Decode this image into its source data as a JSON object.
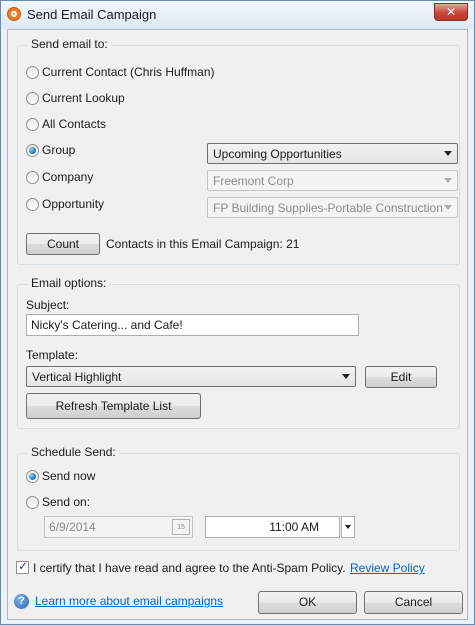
{
  "window": {
    "title": "Send Email Campaign",
    "close_glyph": "✕"
  },
  "send_to": {
    "legend": "Send email to:",
    "options": [
      {
        "label": "Current Contact (Chris Huffman)",
        "checked": false
      },
      {
        "label": "Current Lookup",
        "checked": false
      },
      {
        "label": "All Contacts",
        "checked": false
      },
      {
        "label": "Group",
        "checked": true
      },
      {
        "label": "Company",
        "checked": false
      },
      {
        "label": "Opportunity",
        "checked": false
      }
    ],
    "group_select": "Upcoming Opportunities",
    "company_select": "Freemont Corp",
    "opportunity_select": "FP Building Supplies-Portable Construction",
    "count_button": "Count",
    "contacts_text": "Contacts in this Email Campaign: 21"
  },
  "email_options": {
    "legend": "Email options:",
    "subject_label": "Subject:",
    "subject_value": "Nicky's Catering... and Cafe!",
    "template_label": "Template:",
    "template_value": "Vertical Highlight",
    "edit_button": "Edit",
    "refresh_button": "Refresh Template List"
  },
  "schedule": {
    "legend": "Schedule Send:",
    "send_now": "Send now",
    "send_on": "Send on:",
    "date_value": "6/9/2014",
    "calendar_day": "15",
    "time_value": "11:00 AM"
  },
  "footer": {
    "certify_text": "I certify that I have read and agree to the Anti-Spam Policy.",
    "review_link": "Review Policy",
    "help_glyph": "?",
    "learn_link": "Learn more about email campaigns",
    "ok_button": "OK",
    "cancel_button": "Cancel"
  }
}
